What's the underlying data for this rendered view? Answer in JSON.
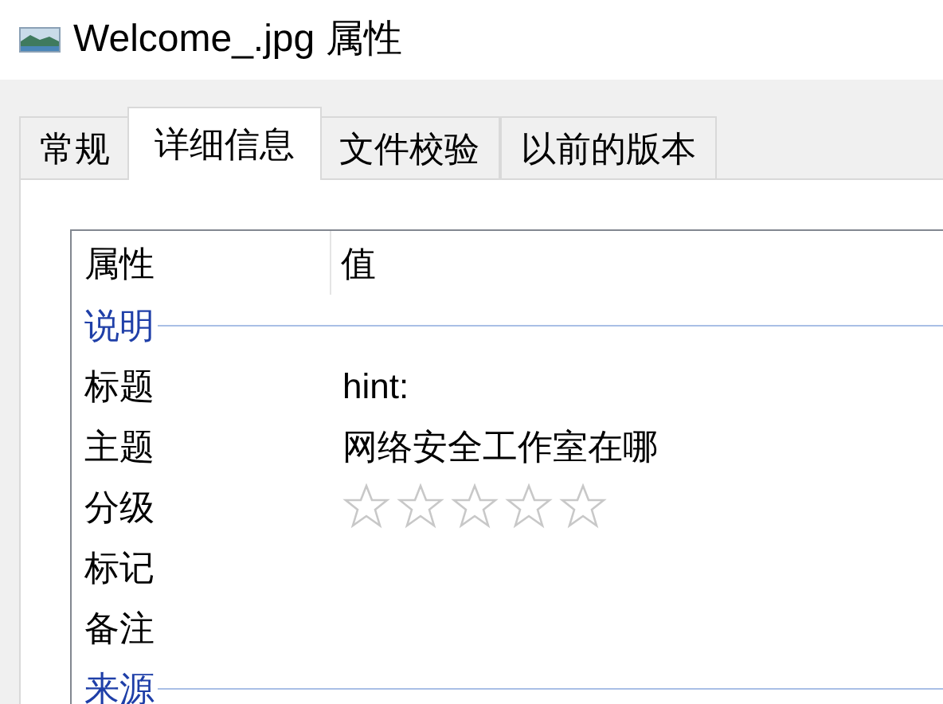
{
  "window": {
    "title": "Welcome_.jpg 属性"
  },
  "tabs": [
    {
      "label": "常规",
      "selected": false
    },
    {
      "label": "详细信息",
      "selected": true
    },
    {
      "label": "文件校验",
      "selected": false
    },
    {
      "label": "以前的版本",
      "selected": false
    }
  ],
  "table": {
    "columns": [
      "属性",
      "值"
    ],
    "groups": [
      {
        "label": "说明",
        "rows": [
          {
            "kind": "text",
            "name": "标题",
            "value": "hint:"
          },
          {
            "kind": "text",
            "name": "主题",
            "value": "网络安全工作室在哪"
          },
          {
            "kind": "rating",
            "name": "分级",
            "stars": 0
          },
          {
            "kind": "text",
            "name": "标记"
          },
          {
            "kind": "text",
            "name": "备注"
          }
        ]
      },
      {
        "label": "来源"
      }
    ]
  }
}
